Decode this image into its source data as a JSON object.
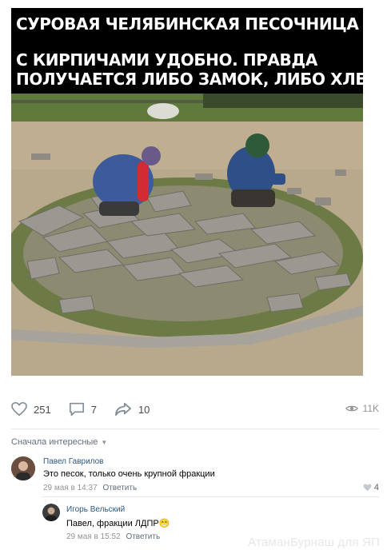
{
  "post": {
    "caption_lines": [
      "СУРОВАЯ ЧЕЛЯБИНСКАЯ ПЕСОЧНИЦА",
      "С КИРПИЧАМИ УДОБНО. ПРАВДА",
      "ПОЛУЧАЕТСЯ ЛИБО ЗАМОК, ЛИБО ХЛЕБ"
    ]
  },
  "actions": {
    "likes": "251",
    "comments": "7",
    "shares": "10",
    "views": "11K"
  },
  "comments_section": {
    "sort_label": "Сначала интересные"
  },
  "comments": [
    {
      "author": "Павел Гаврилов",
      "text": "Это песок, только очень крупной фракции",
      "date": "29 мая в 14:37",
      "reply_label": "Ответить",
      "likes": "4"
    },
    {
      "author": "Игорь Вельский",
      "text": "Павел, фракции ЛДПР😁",
      "date": "29 мая в 15:52",
      "reply_label": "Ответить"
    }
  ],
  "watermark": "АтаманБурнаш для ЯП",
  "colors": {
    "link": "#2a5885",
    "meta": "#939393",
    "icon": "#818c99"
  }
}
